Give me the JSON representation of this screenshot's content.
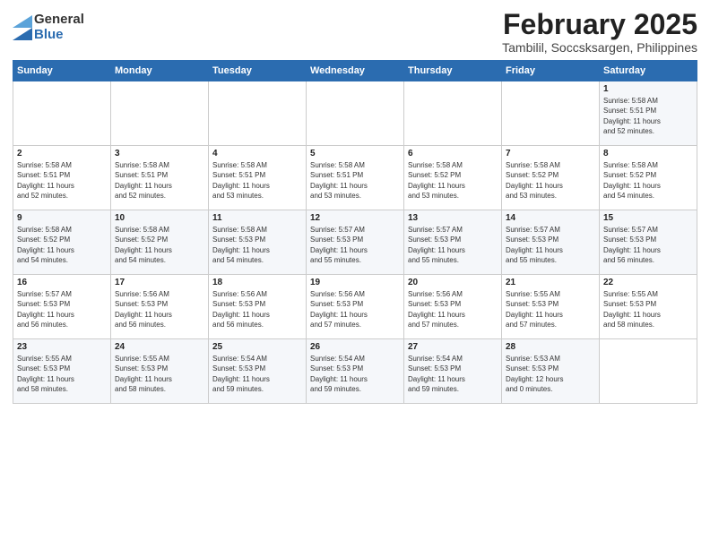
{
  "logo": {
    "general": "General",
    "blue": "Blue"
  },
  "title": "February 2025",
  "subtitle": "Tambilil, Soccsksargen, Philippines",
  "headers": [
    "Sunday",
    "Monday",
    "Tuesday",
    "Wednesday",
    "Thursday",
    "Friday",
    "Saturday"
  ],
  "weeks": [
    [
      {
        "day": "",
        "info": ""
      },
      {
        "day": "",
        "info": ""
      },
      {
        "day": "",
        "info": ""
      },
      {
        "day": "",
        "info": ""
      },
      {
        "day": "",
        "info": ""
      },
      {
        "day": "",
        "info": ""
      },
      {
        "day": "1",
        "info": "Sunrise: 5:58 AM\nSunset: 5:51 PM\nDaylight: 11 hours\nand 52 minutes."
      }
    ],
    [
      {
        "day": "2",
        "info": "Sunrise: 5:58 AM\nSunset: 5:51 PM\nDaylight: 11 hours\nand 52 minutes."
      },
      {
        "day": "3",
        "info": "Sunrise: 5:58 AM\nSunset: 5:51 PM\nDaylight: 11 hours\nand 52 minutes."
      },
      {
        "day": "4",
        "info": "Sunrise: 5:58 AM\nSunset: 5:51 PM\nDaylight: 11 hours\nand 53 minutes."
      },
      {
        "day": "5",
        "info": "Sunrise: 5:58 AM\nSunset: 5:51 PM\nDaylight: 11 hours\nand 53 minutes."
      },
      {
        "day": "6",
        "info": "Sunrise: 5:58 AM\nSunset: 5:52 PM\nDaylight: 11 hours\nand 53 minutes."
      },
      {
        "day": "7",
        "info": "Sunrise: 5:58 AM\nSunset: 5:52 PM\nDaylight: 11 hours\nand 53 minutes."
      },
      {
        "day": "8",
        "info": "Sunrise: 5:58 AM\nSunset: 5:52 PM\nDaylight: 11 hours\nand 54 minutes."
      }
    ],
    [
      {
        "day": "9",
        "info": "Sunrise: 5:58 AM\nSunset: 5:52 PM\nDaylight: 11 hours\nand 54 minutes."
      },
      {
        "day": "10",
        "info": "Sunrise: 5:58 AM\nSunset: 5:52 PM\nDaylight: 11 hours\nand 54 minutes."
      },
      {
        "day": "11",
        "info": "Sunrise: 5:58 AM\nSunset: 5:53 PM\nDaylight: 11 hours\nand 54 minutes."
      },
      {
        "day": "12",
        "info": "Sunrise: 5:57 AM\nSunset: 5:53 PM\nDaylight: 11 hours\nand 55 minutes."
      },
      {
        "day": "13",
        "info": "Sunrise: 5:57 AM\nSunset: 5:53 PM\nDaylight: 11 hours\nand 55 minutes."
      },
      {
        "day": "14",
        "info": "Sunrise: 5:57 AM\nSunset: 5:53 PM\nDaylight: 11 hours\nand 55 minutes."
      },
      {
        "day": "15",
        "info": "Sunrise: 5:57 AM\nSunset: 5:53 PM\nDaylight: 11 hours\nand 56 minutes."
      }
    ],
    [
      {
        "day": "16",
        "info": "Sunrise: 5:57 AM\nSunset: 5:53 PM\nDaylight: 11 hours\nand 56 minutes."
      },
      {
        "day": "17",
        "info": "Sunrise: 5:56 AM\nSunset: 5:53 PM\nDaylight: 11 hours\nand 56 minutes."
      },
      {
        "day": "18",
        "info": "Sunrise: 5:56 AM\nSunset: 5:53 PM\nDaylight: 11 hours\nand 56 minutes."
      },
      {
        "day": "19",
        "info": "Sunrise: 5:56 AM\nSunset: 5:53 PM\nDaylight: 11 hours\nand 57 minutes."
      },
      {
        "day": "20",
        "info": "Sunrise: 5:56 AM\nSunset: 5:53 PM\nDaylight: 11 hours\nand 57 minutes."
      },
      {
        "day": "21",
        "info": "Sunrise: 5:55 AM\nSunset: 5:53 PM\nDaylight: 11 hours\nand 57 minutes."
      },
      {
        "day": "22",
        "info": "Sunrise: 5:55 AM\nSunset: 5:53 PM\nDaylight: 11 hours\nand 58 minutes."
      }
    ],
    [
      {
        "day": "23",
        "info": "Sunrise: 5:55 AM\nSunset: 5:53 PM\nDaylight: 11 hours\nand 58 minutes."
      },
      {
        "day": "24",
        "info": "Sunrise: 5:55 AM\nSunset: 5:53 PM\nDaylight: 11 hours\nand 58 minutes."
      },
      {
        "day": "25",
        "info": "Sunrise: 5:54 AM\nSunset: 5:53 PM\nDaylight: 11 hours\nand 59 minutes."
      },
      {
        "day": "26",
        "info": "Sunrise: 5:54 AM\nSunset: 5:53 PM\nDaylight: 11 hours\nand 59 minutes."
      },
      {
        "day": "27",
        "info": "Sunrise: 5:54 AM\nSunset: 5:53 PM\nDaylight: 11 hours\nand 59 minutes."
      },
      {
        "day": "28",
        "info": "Sunrise: 5:53 AM\nSunset: 5:53 PM\nDaylight: 12 hours\nand 0 minutes."
      },
      {
        "day": "",
        "info": ""
      }
    ]
  ]
}
